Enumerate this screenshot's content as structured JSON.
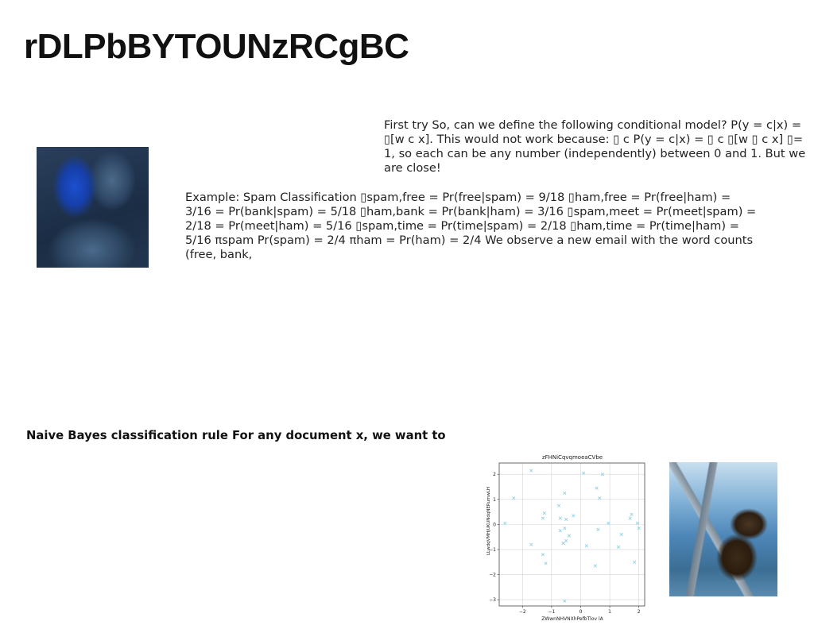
{
  "page": {
    "title": "rDLPbBYTOUNzRCgBC",
    "para_1": "First try So, can we define the following conditional model? P(y = c|x) = ▯[w c x]. This would not work because: ▯ c P(y = c|x) = ▯ c ▯[w ▯ c x] ▯= 1, so each can be any number (independently) between 0 and 1. But we are close!",
    "para_2": "Example: Spam Classification ▯spam,free = Pr(free|spam) = 9/18 ▯ham,free = Pr(free|ham) = 3/16 = Pr(bank|spam) = 5/18 ▯ham,bank = Pr(bank|ham) = 3/16 ▯spam,meet = Pr(meet|spam) = 2/18 = Pr(meet|ham) = 5/16 ▯spam,time = Pr(time|spam) = 2/18 ▯ham,time = Pr(time|ham) = 5/16 πspam Pr(spam) = 2/4 πham = Pr(ham) = 2/4 We observe a new email with the word counts (free, bank,",
    "heading_2": "Naive Bayes classification rule For any document x, we want to"
  },
  "images": {
    "photo_1": "couple-photo",
    "photo_2": "bear-photo"
  },
  "chart_data": {
    "type": "scatter",
    "title": "zFHNiCqvqmoeaCVbe",
    "xlabel": "ZWwnNHVNXhPefbTlov lA",
    "ylabel": "LLwdqVMHjUKUNdqNERumwLH",
    "xlim": [
      -2.8,
      2.2
    ],
    "ylim": [
      -3.25,
      2.45
    ],
    "xticks": [
      -2,
      -1,
      0,
      1,
      2
    ],
    "yticks": [
      2,
      1,
      0,
      -1,
      -2,
      -3
    ],
    "grid": true,
    "marker": "x",
    "color": "#8fd3e6",
    "points": [
      [
        -1.7,
        2.15
      ],
      [
        -2.3,
        1.05
      ],
      [
        -2.6,
        0.05
      ],
      [
        -1.3,
        0.25
      ],
      [
        -1.25,
        0.45
      ],
      [
        -1.3,
        -1.2
      ],
      [
        -1.2,
        -1.55
      ],
      [
        -1.7,
        -0.8
      ],
      [
        -0.75,
        0.75
      ],
      [
        -0.55,
        1.25
      ],
      [
        -0.7,
        0.25
      ],
      [
        -0.5,
        0.2
      ],
      [
        -0.55,
        -0.15
      ],
      [
        -0.7,
        -0.25
      ],
      [
        -0.4,
        -0.45
      ],
      [
        -0.5,
        -0.65
      ],
      [
        -0.6,
        -0.75
      ],
      [
        -0.25,
        0.35
      ],
      [
        -0.55,
        -3.05
      ],
      [
        0.1,
        2.05
      ],
      [
        0.75,
        2.0
      ],
      [
        0.55,
        1.45
      ],
      [
        0.65,
        1.05
      ],
      [
        0.95,
        0.05
      ],
      [
        0.6,
        -0.2
      ],
      [
        0.2,
        -0.85
      ],
      [
        0.5,
        -1.65
      ],
      [
        1.3,
        -0.9
      ],
      [
        1.4,
        -0.4
      ],
      [
        1.7,
        0.25
      ],
      [
        1.75,
        0.4
      ],
      [
        1.95,
        0.05
      ],
      [
        2.0,
        -0.15
      ],
      [
        1.85,
        -1.5
      ]
    ]
  },
  "colors": {
    "text": "#222222",
    "grid": "#d4d4d4",
    "axis": "#333333",
    "marker": "#8fd3e6"
  }
}
